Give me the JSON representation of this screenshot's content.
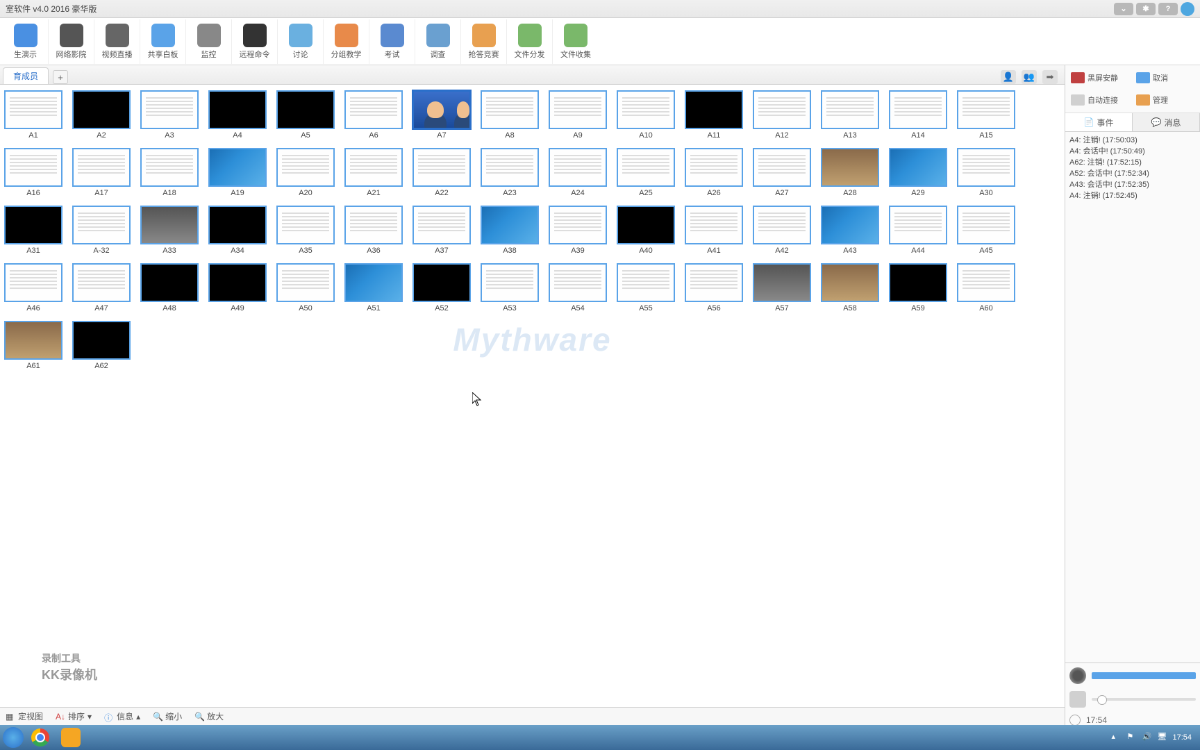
{
  "title": "室软件 v4.0 2016 豪华版",
  "toolbar": [
    {
      "label": "生演示",
      "color": "#4a90e2"
    },
    {
      "label": "网络影院",
      "color": "#555"
    },
    {
      "label": "视频直播",
      "color": "#666"
    },
    {
      "label": "共享白板",
      "color": "#5aa3e8"
    },
    {
      "label": "监控",
      "color": "#888"
    },
    {
      "label": "远程命令",
      "color": "#333"
    },
    {
      "label": "讨论",
      "color": "#6ab0e0"
    },
    {
      "label": "分组教学",
      "color": "#e88a4a"
    },
    {
      "label": "考试",
      "color": "#5a8ad0"
    },
    {
      "label": "调查",
      "color": "#6aa0d0"
    },
    {
      "label": "抢答竞赛",
      "color": "#e8a050"
    },
    {
      "label": "文件分发",
      "color": "#7ab86a"
    },
    {
      "label": "文件收集",
      "color": "#7ab86a"
    }
  ],
  "tab": {
    "label": "育成员"
  },
  "thumbs": [
    {
      "id": "A1",
      "type": "doc"
    },
    {
      "id": "A2",
      "type": "black"
    },
    {
      "id": "A3",
      "type": "doc"
    },
    {
      "id": "A4",
      "type": "black"
    },
    {
      "id": "A5",
      "type": "black"
    },
    {
      "id": "A6",
      "type": "doc"
    },
    {
      "id": "A7",
      "type": "avatar",
      "selected": true
    },
    {
      "id": "A8",
      "type": "doc"
    },
    {
      "id": "A9",
      "type": "doc"
    },
    {
      "id": "A10",
      "type": "doc"
    },
    {
      "id": "A11",
      "type": "black"
    },
    {
      "id": "A12",
      "type": "doc"
    },
    {
      "id": "A13",
      "type": "doc"
    },
    {
      "id": "A14",
      "type": "doc"
    },
    {
      "id": "A15",
      "type": "doc"
    },
    {
      "id": "A16",
      "type": "doc"
    },
    {
      "id": "A17",
      "type": "doc"
    },
    {
      "id": "A18",
      "type": "doc"
    },
    {
      "id": "A19",
      "type": "win7"
    },
    {
      "id": "A20",
      "type": "doc"
    },
    {
      "id": "A21",
      "type": "doc"
    },
    {
      "id": "A22",
      "type": "doc"
    },
    {
      "id": "A23",
      "type": "doc"
    },
    {
      "id": "A24",
      "type": "doc"
    },
    {
      "id": "A25",
      "type": "doc"
    },
    {
      "id": "A26",
      "type": "doc"
    },
    {
      "id": "A27",
      "type": "doc"
    },
    {
      "id": "A28",
      "type": "photo"
    },
    {
      "id": "A29",
      "type": "win7"
    },
    {
      "id": "A30",
      "type": "doc"
    },
    {
      "id": "A31",
      "type": "black"
    },
    {
      "id": "A-32",
      "type": "doc"
    },
    {
      "id": "A33",
      "type": "photo2"
    },
    {
      "id": "A34",
      "type": "black"
    },
    {
      "id": "A35",
      "type": "doc"
    },
    {
      "id": "A36",
      "type": "doc"
    },
    {
      "id": "A37",
      "type": "doc"
    },
    {
      "id": "A38",
      "type": "win7"
    },
    {
      "id": "A39",
      "type": "doc"
    },
    {
      "id": "A40",
      "type": "black"
    },
    {
      "id": "A41",
      "type": "doc"
    },
    {
      "id": "A42",
      "type": "doc"
    },
    {
      "id": "A43",
      "type": "win7"
    },
    {
      "id": "A44",
      "type": "doc"
    },
    {
      "id": "A45",
      "type": "doc"
    },
    {
      "id": "A46",
      "type": "doc"
    },
    {
      "id": "A47",
      "type": "doc"
    },
    {
      "id": "A48",
      "type": "black"
    },
    {
      "id": "A49",
      "type": "black"
    },
    {
      "id": "A50",
      "type": "doc"
    },
    {
      "id": "A51",
      "type": "win7"
    },
    {
      "id": "A52",
      "type": "black"
    },
    {
      "id": "A53",
      "type": "doc"
    },
    {
      "id": "A54",
      "type": "doc"
    },
    {
      "id": "A55",
      "type": "doc"
    },
    {
      "id": "A56",
      "type": "doc"
    },
    {
      "id": "A57",
      "type": "photo2"
    },
    {
      "id": "A58",
      "type": "photo"
    },
    {
      "id": "A59",
      "type": "black"
    },
    {
      "id": "A60",
      "type": "doc"
    },
    {
      "id": "A61",
      "type": "photo"
    },
    {
      "id": "A62",
      "type": "black"
    }
  ],
  "watermark": "Mythware",
  "recorder": {
    "line1": "录制工具",
    "line2": "KK录像机"
  },
  "status": {
    "view": "定视图",
    "sort": "排序",
    "info": "信息",
    "zoomout": "缩小",
    "zoomin": "放大"
  },
  "side": {
    "blackscreen": "黑屏安静",
    "cancel": "取消",
    "autoconnect": "自动连接",
    "manage": "管理",
    "tab_events": "事件",
    "tab_messages": "消息",
    "events": [
      "A4: 注销! (17:50:03)",
      "A4: 会话中! (17:50:49)",
      "A62: 注销! (17:52:15)",
      "A52: 会话中! (17:52:34)",
      "A43: 会话中! (17:52:35)",
      "A4: 注销! (17:52:45)"
    ],
    "time": "17:54"
  },
  "tray": {
    "time": "17:54"
  }
}
